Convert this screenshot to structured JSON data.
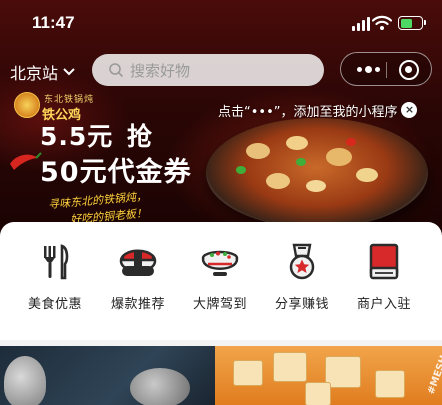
{
  "status_bar": {
    "time": "11:47"
  },
  "header": {
    "city": "北京站",
    "search_placeholder": "搜索好物"
  },
  "tooltip": {
    "text": "点击“•••”，添加至我的小程序",
    "close": "×"
  },
  "banner": {
    "brand_sub": "东北铁锅炖",
    "brand_name": "铁公鸡",
    "promo_line1_price": "5.5元",
    "promo_line1_action": "抢",
    "promo_line2": "50元代金券",
    "slogan1": "寻味东北的铁锅炖，",
    "slogan2": "好吃的铜老板！"
  },
  "categories": [
    {
      "label": "美食优惠",
      "icon": "fork-knife-icon"
    },
    {
      "label": "爆款推荐",
      "icon": "sushi-icon"
    },
    {
      "label": "大牌驾到",
      "icon": "bowl-icon"
    },
    {
      "label": "分享赚钱",
      "icon": "medal-icon"
    },
    {
      "label": "商户入驻",
      "icon": "book-icon"
    }
  ],
  "bottom": {
    "tag": "#MESH"
  },
  "colors": {
    "accent_red": "#d7282a",
    "icon_dark": "#2b2b2b",
    "brand_gold": "#ffd23d"
  }
}
